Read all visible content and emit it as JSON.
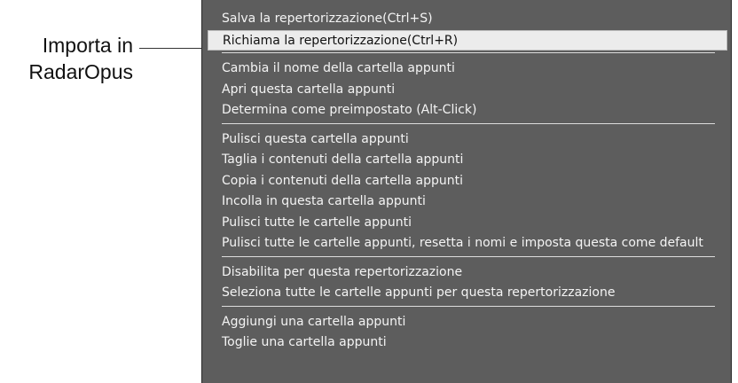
{
  "callout": {
    "line1": "Importa in",
    "line2": "RadarOpus"
  },
  "menu": {
    "groups": [
      [
        "Salva la repertorizzazione(Ctrl+S)",
        "Richiama la repertorizzazione(Ctrl+R)"
      ],
      [
        "Cambia il nome della cartella appunti",
        "Apri questa cartella appunti",
        "Determina come preimpostato (Alt-Click)"
      ],
      [
        "Pulisci questa cartella appunti",
        "Taglia i contenuti della cartella appunti",
        "Copia i contenuti della cartella appunti",
        "Incolla in questa cartella appunti",
        "Pulisci tutte le cartelle appunti",
        "Pulisci tutte le cartelle appunti, resetta i nomi e imposta questa come default"
      ],
      [
        "Disabilita per questa repertorizzazione",
        "Seleziona tutte le cartelle appunti per questa repertorizzazione"
      ],
      [
        "Aggiungi una cartella appunti",
        "Toglie una cartella appunti"
      ]
    ],
    "highlighted": "Richiama la repertorizzazione(Ctrl+R)"
  },
  "colors": {
    "menu_background": "#5d5d5d",
    "menu_text": "#f4f4f4",
    "highlight_background": "#ececec",
    "separator": "#dcdcdc"
  }
}
